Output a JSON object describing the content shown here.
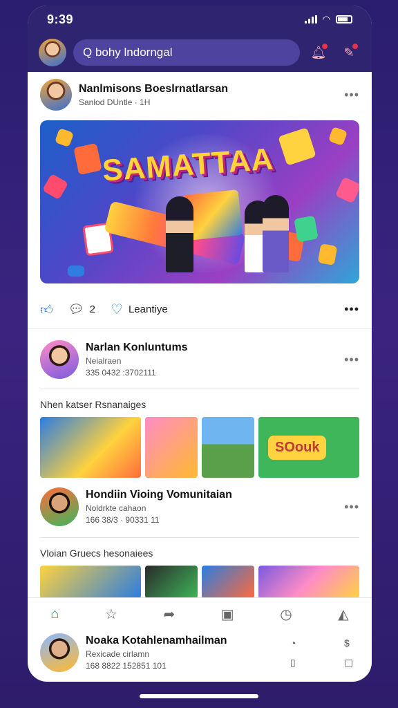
{
  "status": {
    "time": "9:39"
  },
  "header": {
    "search_text": "Q bohy lndorngal"
  },
  "post1": {
    "author": "Nanlmisons Boeslrnatlarsan",
    "meta": "Sanlod DUntle · 1H",
    "banner_text": "SAMATTAA"
  },
  "actions": {
    "comments": "2",
    "like_label": "Leantiye"
  },
  "post2": {
    "author": "Narlan Konluntums",
    "sub": "Neialraen",
    "meta": "335 0432 :3702111"
  },
  "section1": {
    "title": "Nhen katser Rsnanaiges",
    "card_text": "SOouk"
  },
  "post3": {
    "author": "Hondiin Vioing Vomunitaian",
    "sub": "Noldrkte cahaon",
    "meta": "166 38/3 · 90331 11"
  },
  "section2": {
    "title": "Vloian Gruecs hesonaiees"
  },
  "bottom_post": {
    "author": "Noaka Kotahlenamhailman",
    "sub": "Rexicade cirlamn",
    "meta": "168 8822 152851 101"
  }
}
